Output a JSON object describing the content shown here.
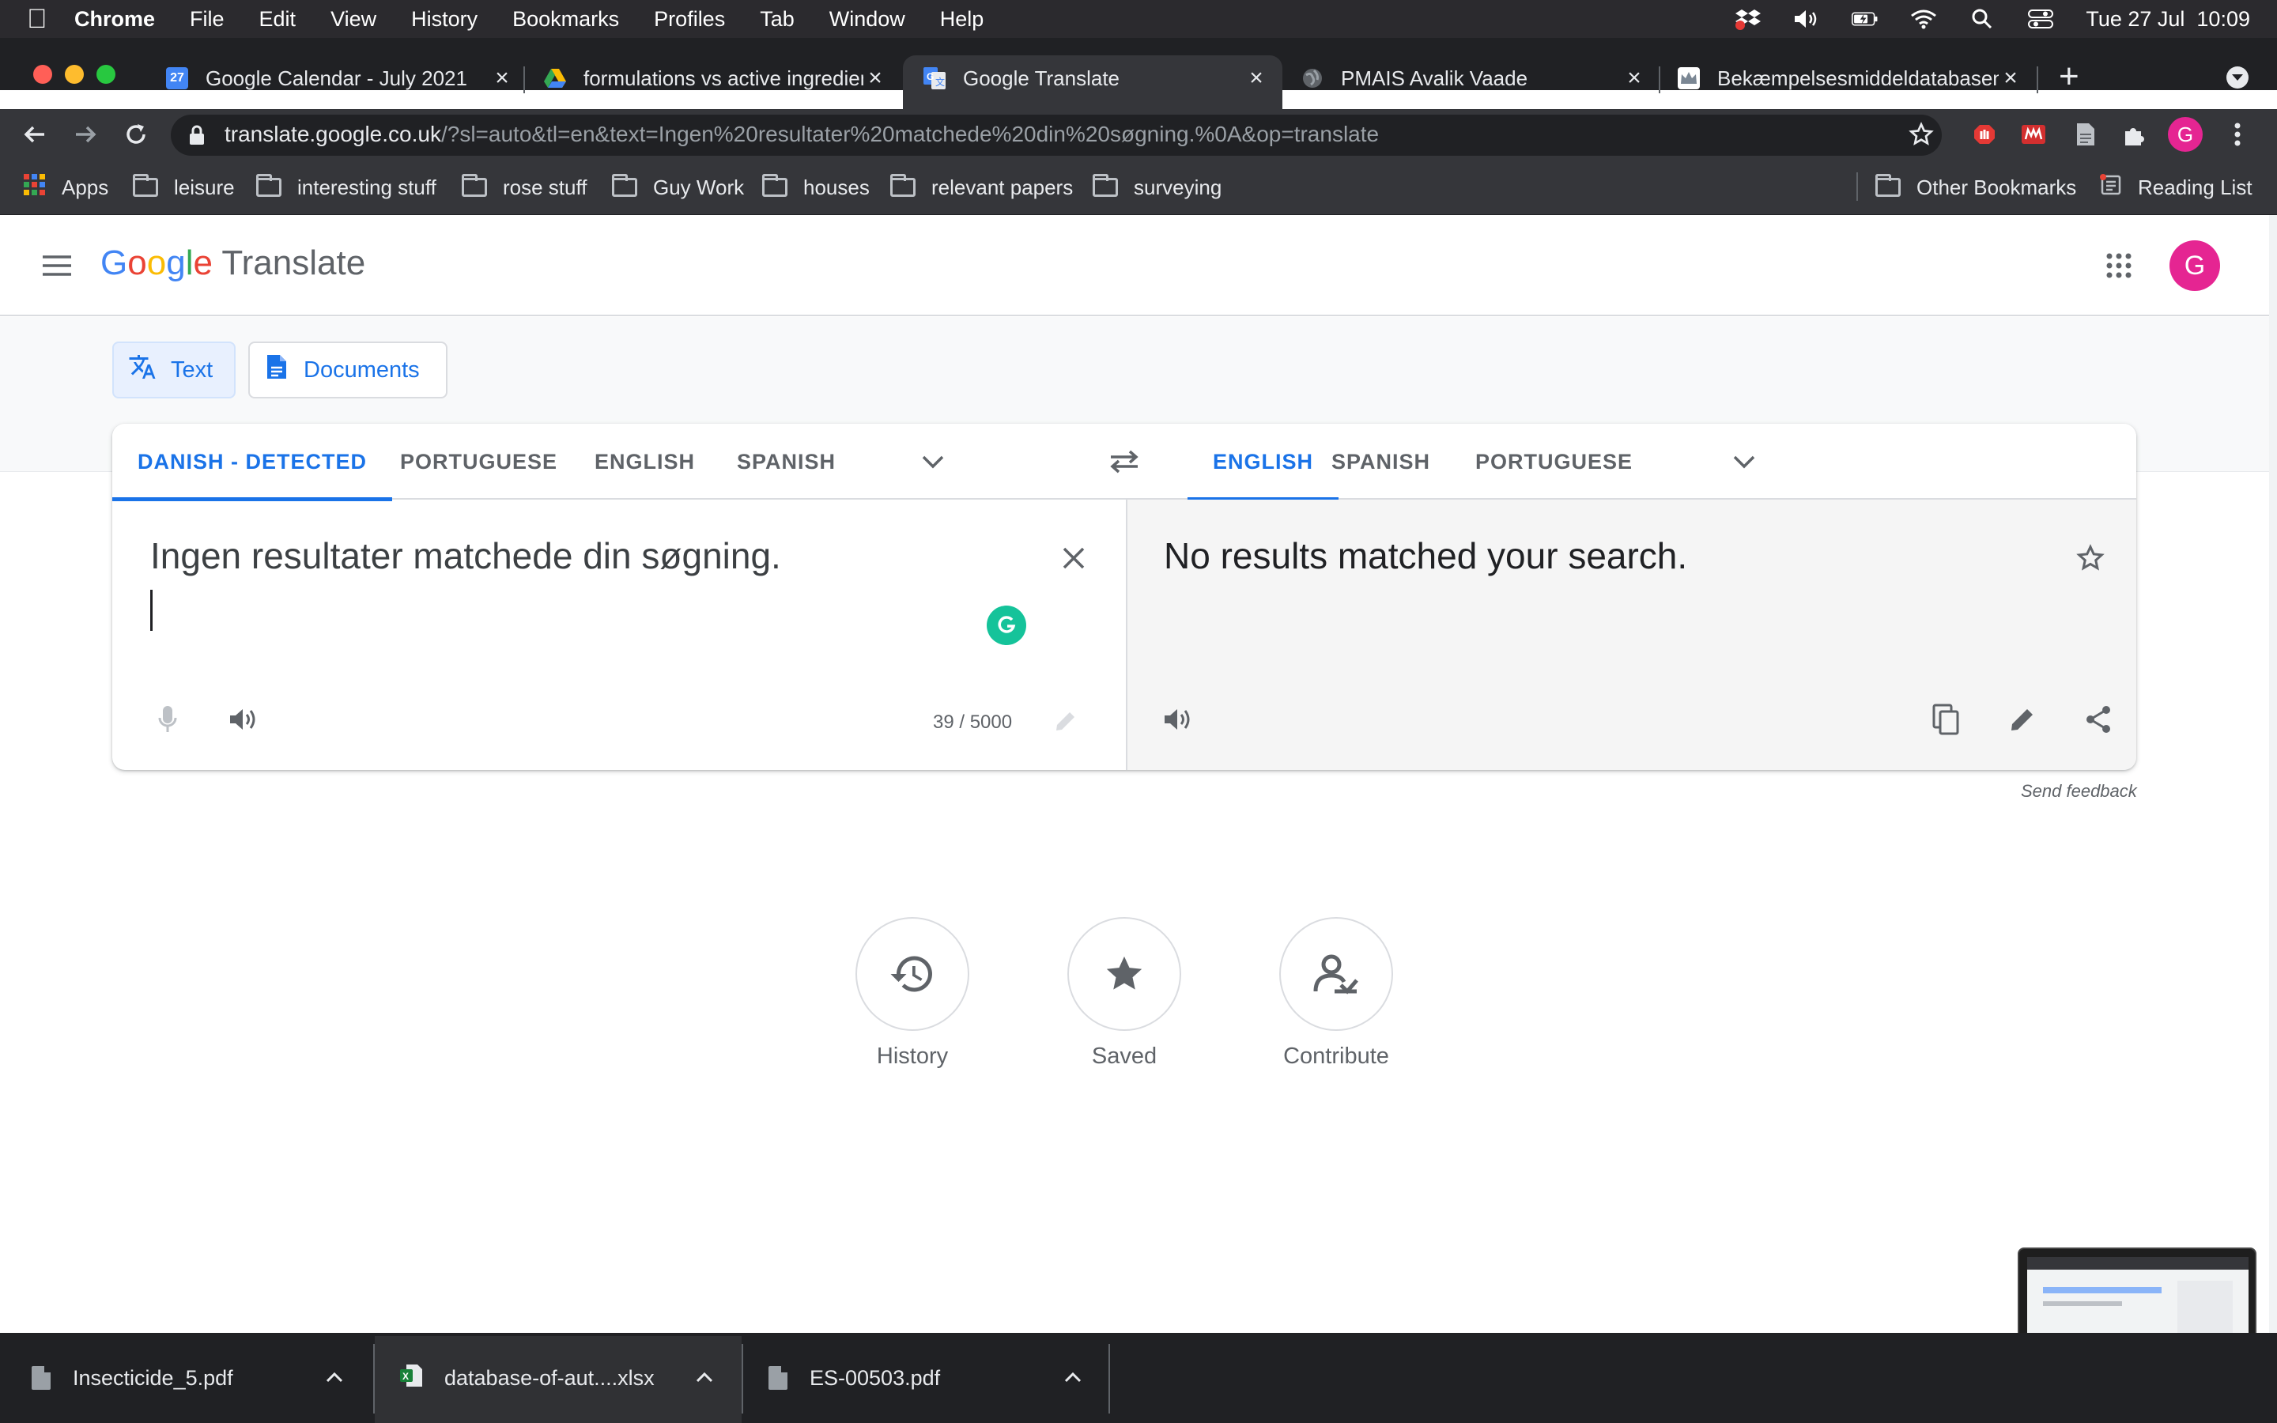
{
  "menubar": {
    "items": [
      "Chrome",
      "File",
      "Edit",
      "View",
      "History",
      "Bookmarks",
      "Profiles",
      "Tab",
      "Window",
      "Help"
    ],
    "clock": "Tue 27 Jul  10:09"
  },
  "tabs": [
    {
      "title": "Google Calendar - July 2021",
      "icon": "calendar-favicon",
      "color": "#4285f4",
      "label": "27"
    },
    {
      "title": "formulations vs active ingredients",
      "icon": "drive-favicon",
      "color": "#fbbc04"
    },
    {
      "title": "Google Translate",
      "icon": "translate-favicon",
      "color": "#4285f4"
    },
    {
      "title": "PMAIS Avalik Vaade",
      "icon": "globe-favicon",
      "color": "#9aa0a6"
    },
    {
      "title": "Bekæmpelsesmiddeldatabasen",
      "icon": "crown-favicon",
      "color": "#ffffff"
    }
  ],
  "toolbar": {
    "url_host": "translate.google.co.uk",
    "url_path": "/?sl=auto&tl=en&text=Ingen%20resultater%20matchede%20din%20søgning.%0A&op=translate",
    "profile_initial": "G",
    "profile_color": "#e52592"
  },
  "bookmarks": {
    "apps": "Apps",
    "folders": [
      "leisure",
      "interesting stuff",
      "rose stuff",
      "Guy Work",
      "houses",
      "relevant papers",
      "surveying"
    ],
    "other": "Other Bookmarks",
    "reading": "Reading List"
  },
  "header": {
    "logo_letters": [
      "G",
      "o",
      "o",
      "g",
      "l",
      "e"
    ],
    "logo_colors": [
      "#4285f4",
      "#ea4335",
      "#fbbc04",
      "#4285f4",
      "#34a853",
      "#ea4335"
    ],
    "product": "Translate",
    "avatar_initial": "G",
    "avatar_color": "#e52592"
  },
  "modes": {
    "text": "Text",
    "documents": "Documents"
  },
  "source_langs": [
    "DANISH - DETECTED",
    "PORTUGUESE",
    "ENGLISH",
    "SPANISH"
  ],
  "target_langs": [
    "ENGLISH",
    "SPANISH",
    "PORTUGUESE"
  ],
  "source": {
    "text": "Ingen resultater matchede din søgning.",
    "char_count": "39 / 5000"
  },
  "target": {
    "text": "No results matched your search."
  },
  "feedback": "Send feedback",
  "actions": [
    "History",
    "Saved",
    "Contribute"
  ],
  "downloads": [
    "Insecticide_5.pdf",
    "database-of-aut....xlsx",
    "ES-00503.pdf"
  ],
  "accent": "#1a73e8"
}
